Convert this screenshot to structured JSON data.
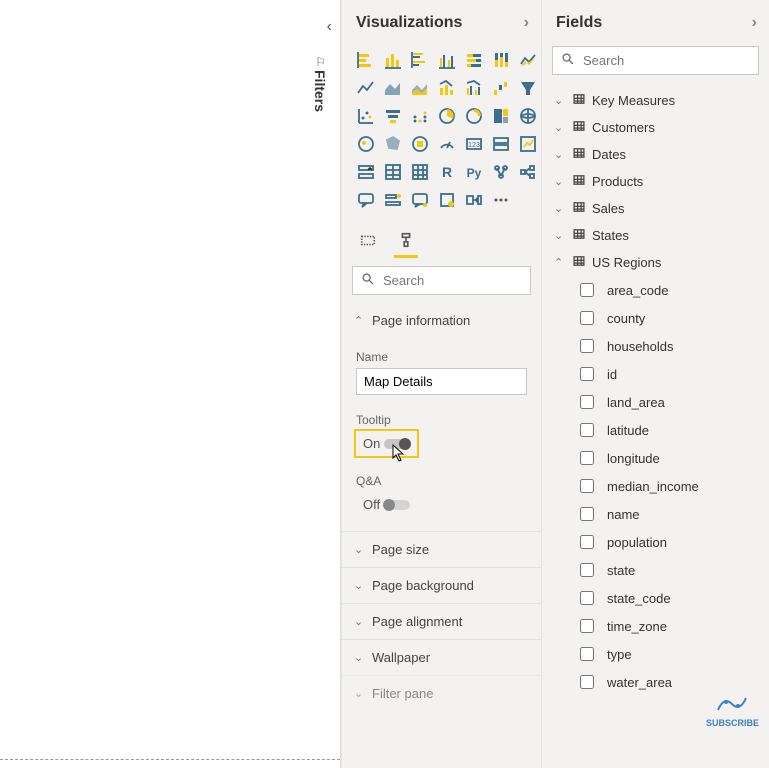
{
  "filters_label": "Filters",
  "visualizations": {
    "title": "Visualizations",
    "tabs": {
      "fields": "Fields",
      "format": "Format"
    },
    "search_placeholder": "Search",
    "sections": {
      "page_information": {
        "title": "Page information",
        "name_label": "Name",
        "name_value": "Map Details",
        "tooltip_label": "Tooltip",
        "tooltip_state": "On",
        "qa_label": "Q&A",
        "qa_state": "Off"
      },
      "page_size": {
        "title": "Page size"
      },
      "page_background": {
        "title": "Page background"
      },
      "page_alignment": {
        "title": "Page alignment"
      },
      "wallpaper": {
        "title": "Wallpaper"
      },
      "filter_pane": {
        "title": "Filter pane"
      }
    },
    "gallery": [
      "stacked-bar",
      "stacked-column",
      "clustered-bar",
      "clustered-column",
      "stacked-bar-100",
      "stacked-column-100",
      "ribbon",
      "line",
      "area",
      "stacked-area",
      "line-stacked-column",
      "line-clustered-column",
      "waterfall",
      "funnel",
      "scatter",
      "pie",
      "donut",
      "treemap",
      "map",
      "filled-map",
      "shape-map",
      "gauge",
      "card",
      "multi-card",
      "kpi",
      "slicer",
      "table",
      "matrix",
      "r-visual",
      "py-visual",
      "key-influencers",
      "decomposition-tree",
      "qa-visual",
      "paginated",
      "more"
    ]
  },
  "fields": {
    "title": "Fields",
    "search_placeholder": "Search",
    "tables": [
      {
        "name": "Key Measures",
        "expanded": false
      },
      {
        "name": "Customers",
        "expanded": false
      },
      {
        "name": "Dates",
        "expanded": false
      },
      {
        "name": "Products",
        "expanded": false
      },
      {
        "name": "Sales",
        "expanded": false
      },
      {
        "name": "States",
        "expanded": false
      },
      {
        "name": "US Regions",
        "expanded": true,
        "columns": [
          "area_code",
          "county",
          "households",
          "id",
          "land_area",
          "latitude",
          "longitude",
          "median_income",
          "name",
          "population",
          "state",
          "state_code",
          "time_zone",
          "type",
          "water_area"
        ]
      }
    ]
  },
  "subscribe": "SUBSCRIBE"
}
